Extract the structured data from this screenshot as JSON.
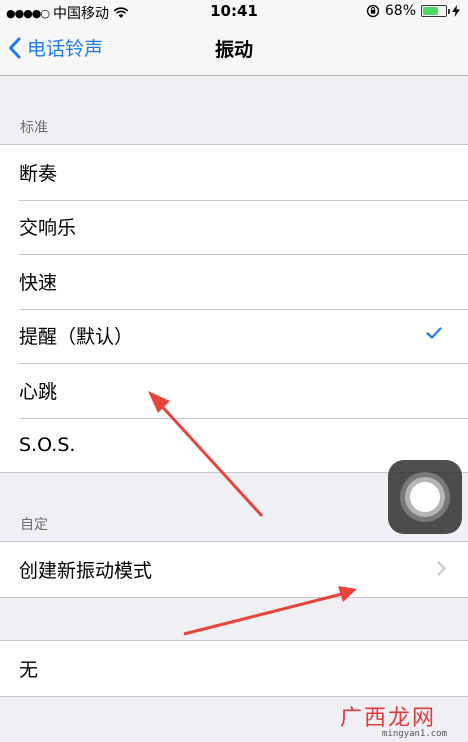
{
  "status_bar": {
    "carrier": "中国移动",
    "time": "10:41",
    "battery": "68%",
    "battery_level": 0.68
  },
  "nav": {
    "back_label": "电话铃声",
    "title": "振动"
  },
  "standard_section": {
    "header": "标准",
    "items": [
      {
        "label": "断奏"
      },
      {
        "label": "交响乐"
      },
      {
        "label": "快速"
      },
      {
        "label": "提醒（默认）",
        "selected": true
      },
      {
        "label": "心跳"
      },
      {
        "label": "S.O.S."
      }
    ]
  },
  "custom_section": {
    "header": "自定",
    "create_label": "创建新振动模式"
  },
  "none_label": "无",
  "watermark": {
    "title": "广西龙网",
    "url": "mingyan1.com"
  },
  "colors": {
    "accent": "#1a7ef0",
    "annotation_arrow": "#e8443a"
  }
}
